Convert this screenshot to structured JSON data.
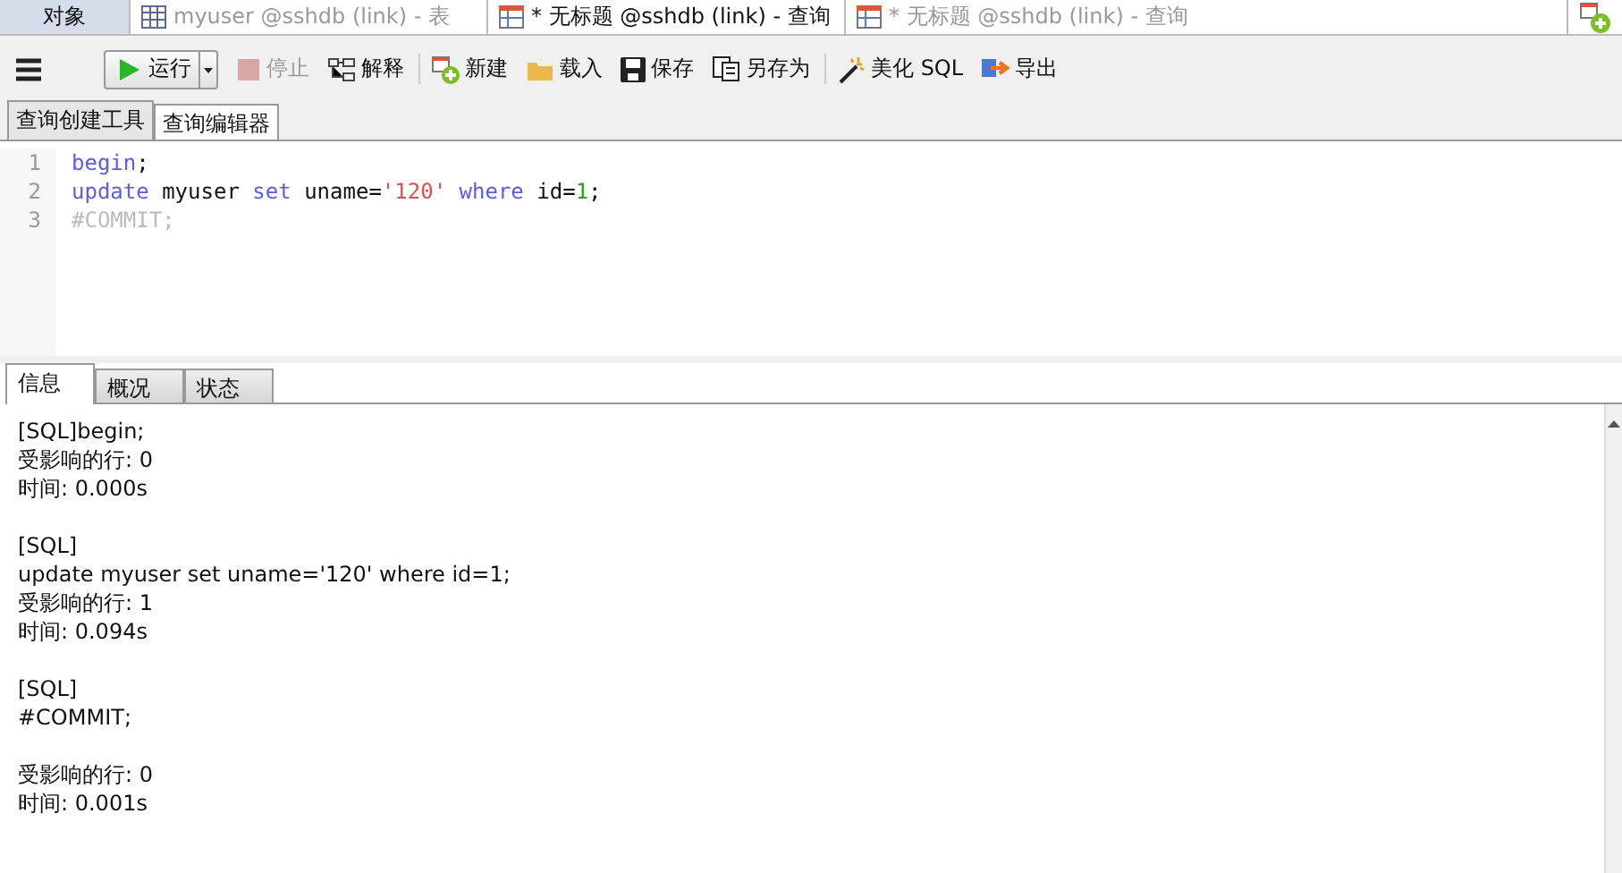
{
  "doc_tabs": [
    {
      "kind": "objects",
      "label": "对象"
    },
    {
      "kind": "table",
      "label": "myuser @sshdb (link) - 表",
      "selected": false
    },
    {
      "kind": "query",
      "label": "* 无标题 @sshdb (link) - 查询",
      "selected": true
    },
    {
      "kind": "query",
      "label": "* 无标题 @sshdb (link) - 查询",
      "selected": false
    }
  ],
  "toolbar": [
    {
      "kind": "run",
      "label": "运行",
      "disabled": false
    },
    {
      "kind": "stop",
      "label": "停止",
      "disabled": true
    },
    {
      "kind": "explain",
      "label": "解释",
      "disabled": false
    },
    {
      "kind": "new",
      "label": "新建",
      "disabled": false
    },
    {
      "kind": "load",
      "label": "载入",
      "disabled": false
    },
    {
      "kind": "save",
      "label": "保存",
      "disabled": false
    },
    {
      "kind": "saveas",
      "label": "另存为",
      "disabled": false
    },
    {
      "kind": "beautify",
      "label": "美化 SQL",
      "disabled": false
    },
    {
      "kind": "export",
      "label": "导出",
      "disabled": false
    }
  ],
  "editor_tabs": [
    {
      "label": "查询创建工具",
      "selected": false
    },
    {
      "label": "查询编辑器",
      "selected": true
    }
  ],
  "code_lines": [
    {
      "number": "1",
      "tokens": [
        {
          "kind": "keyword",
          "text": "begin"
        },
        {
          "kind": "plain",
          "text": ";"
        }
      ]
    },
    {
      "number": "2",
      "tokens": [
        {
          "kind": "keyword",
          "text": "update"
        },
        {
          "kind": "plain",
          "text": " myuser "
        },
        {
          "kind": "keyword",
          "text": "set"
        },
        {
          "kind": "plain",
          "text": " uname="
        },
        {
          "kind": "string",
          "text": "'120'"
        },
        {
          "kind": "keyword",
          "text": " where"
        },
        {
          "kind": "plain",
          "text": " id="
        },
        {
          "kind": "number",
          "text": "1"
        },
        {
          "kind": "plain",
          "text": ";"
        }
      ]
    },
    {
      "number": "3",
      "tokens": [
        {
          "kind": "comment",
          "text": "#COMMIT;"
        }
      ]
    }
  ],
  "result_tabs": [
    {
      "label": "信息",
      "selected": true
    },
    {
      "label": "概况",
      "selected": false
    },
    {
      "label": "状态",
      "selected": false
    }
  ],
  "messages": [
    {
      "lines": [
        "[SQL]begin;",
        "受影响的行: 0",
        "时间: 0.000s"
      ]
    },
    {
      "lines": [
        "[SQL]",
        "update myuser set uname='120' where id=1;",
        "受影响的行: 1",
        "时间: 0.094s"
      ]
    },
    {
      "lines": [
        "[SQL]",
        "#COMMIT;"
      ]
    },
    {
      "lines": [
        "受影响的行: 0",
        "时间: 0.001s"
      ]
    }
  ]
}
